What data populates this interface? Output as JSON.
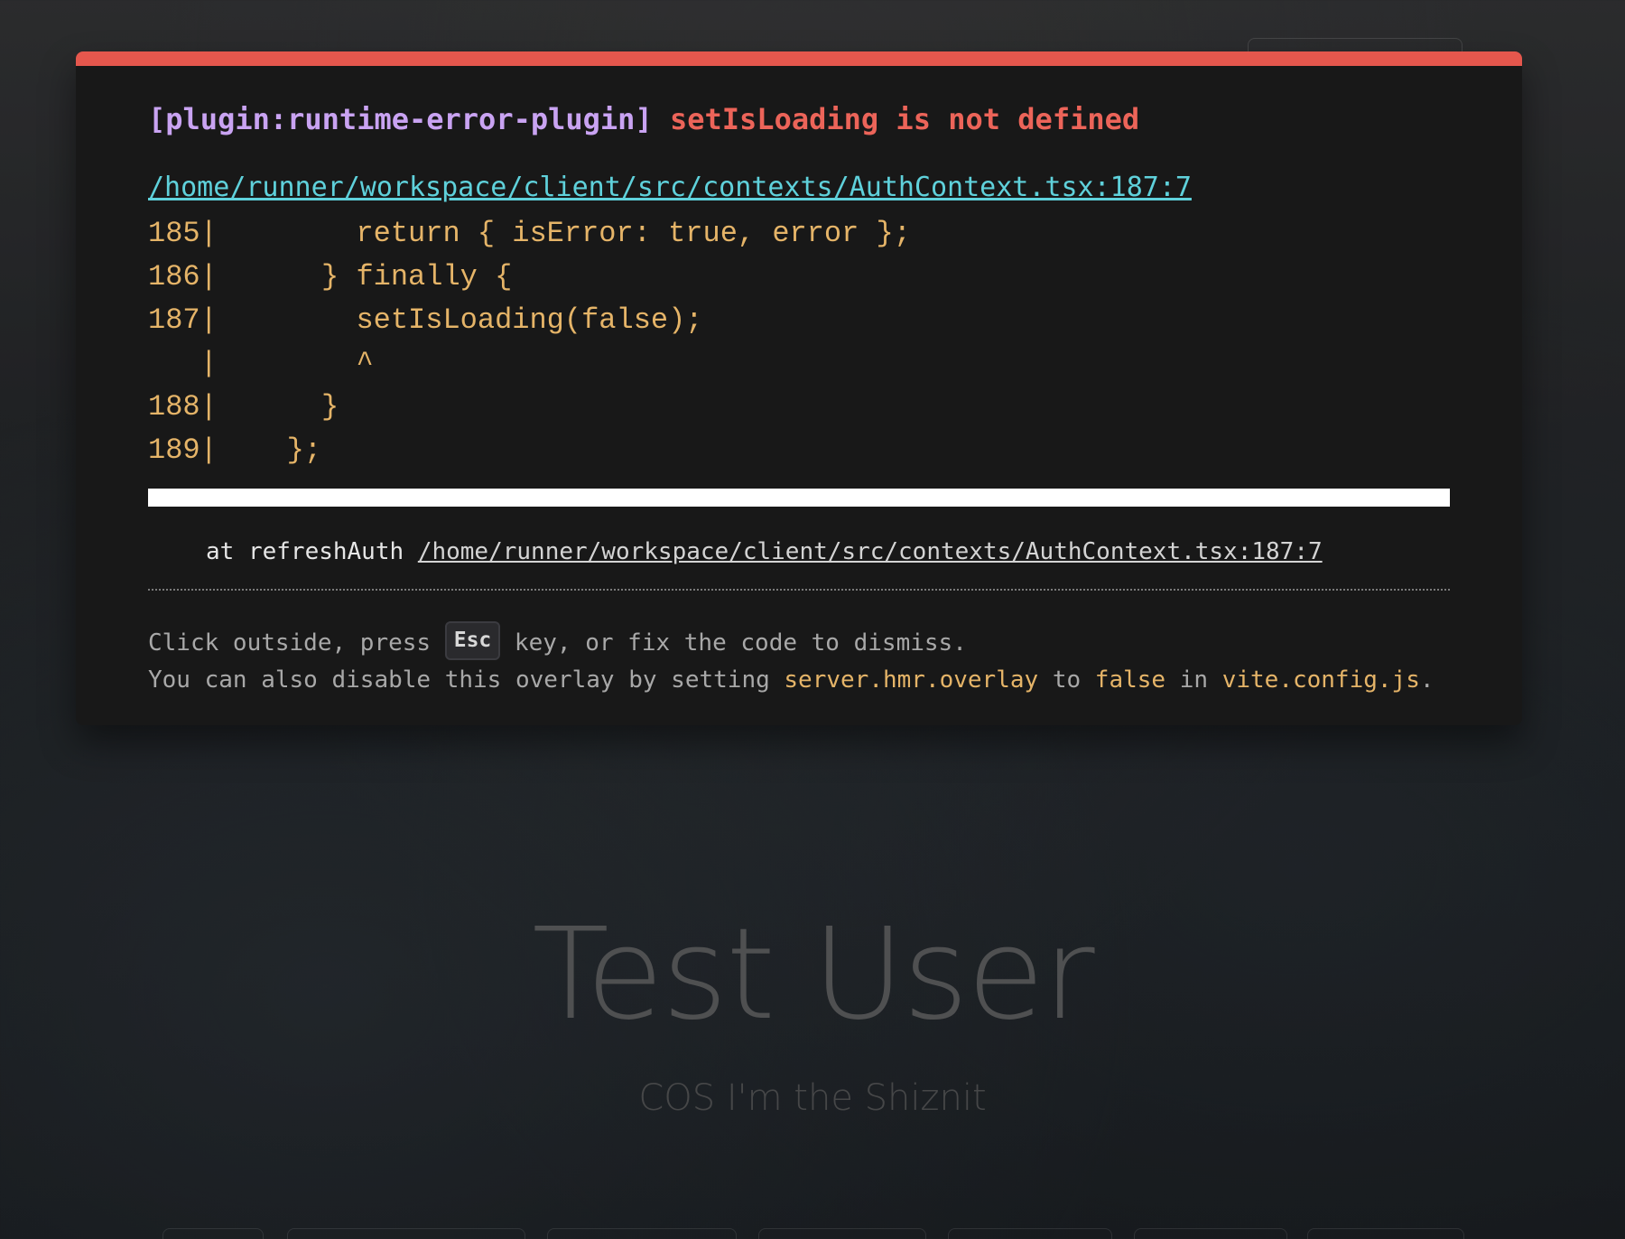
{
  "background_page": {
    "hero_title": "Test User",
    "hero_subtitle": "COS I'm the Shiznit"
  },
  "error_overlay": {
    "plugin_tag": "[plugin:runtime-error-plugin]",
    "message": "setIsLoading is not defined",
    "file_link": "/home/runner/workspace/client/src/contexts/AuthContext.tsx:187:7",
    "code_frame": [
      {
        "gutter": "185|",
        "code": "        return { isError: true, error };"
      },
      {
        "gutter": "186|",
        "code": "      } finally {"
      },
      {
        "gutter": "187|",
        "code": "        setIsLoading(false);"
      },
      {
        "gutter": "   |",
        "code": "        ^"
      },
      {
        "gutter": "188|",
        "code": "      }"
      },
      {
        "gutter": "189|",
        "code": "    };"
      }
    ],
    "stack": {
      "prefix": "at refreshAuth ",
      "link": "/home/runner/workspace/client/src/contexts/AuthContext.tsx:187:7"
    },
    "tip_line1": {
      "before": "Click outside, press ",
      "key": "Esc",
      "after": " key, or fix the code to dismiss."
    },
    "tip_line2": {
      "part1": "You can also disable this overlay by setting ",
      "setting": "server.hmr.overlay",
      "part2": " to ",
      "value": "false",
      "part3": " in ",
      "file": "vite.config.js",
      "part4": "."
    }
  },
  "colors": {
    "top_border": "#e5574d",
    "plugin_tag": "#c9a3f2",
    "error_message": "#ec6459",
    "file_link": "#5fd1db",
    "code": "#e5b468",
    "panel_bg": "#181818"
  }
}
